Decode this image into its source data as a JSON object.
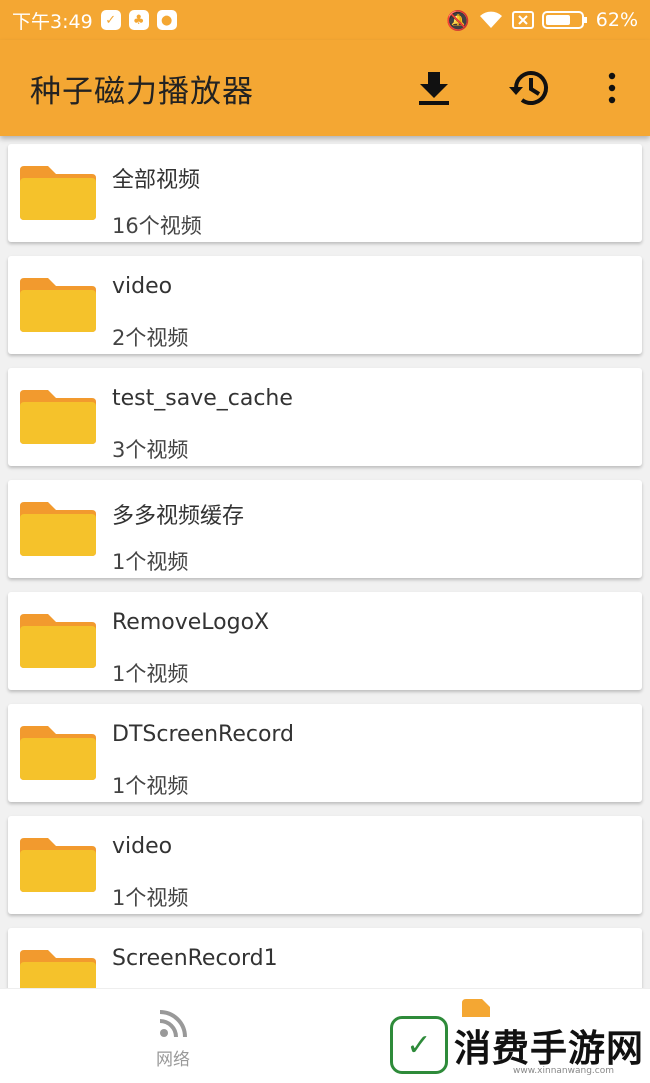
{
  "status_bar": {
    "time": "下午3:49",
    "battery": "62%"
  },
  "app_bar": {
    "title": "种子磁力播放器",
    "icons": [
      "download-icon",
      "history-icon",
      "more-vert-icon"
    ]
  },
  "folders": [
    {
      "name": "全部视频",
      "count": "16个视频"
    },
    {
      "name": "video",
      "count": "2个视频"
    },
    {
      "name": "test_save_cache",
      "count": "3个视频"
    },
    {
      "name": "多多视频缓存",
      "count": "1个视频"
    },
    {
      "name": "RemoveLogoX",
      "count": "1个视频"
    },
    {
      "name": "DTScreenRecord",
      "count": "1个视频"
    },
    {
      "name": "video",
      "count": "1个视频"
    },
    {
      "name": "ScreenRecord1",
      "count": ""
    }
  ],
  "bottom_nav": {
    "network_label": "网络"
  },
  "watermark": {
    "text": "消费手游网",
    "sub": "www.xinnanwang.com"
  },
  "colors": {
    "accent": "#f4a733",
    "folder": "#f5c22b",
    "folder_tab": "#f29a2e"
  }
}
